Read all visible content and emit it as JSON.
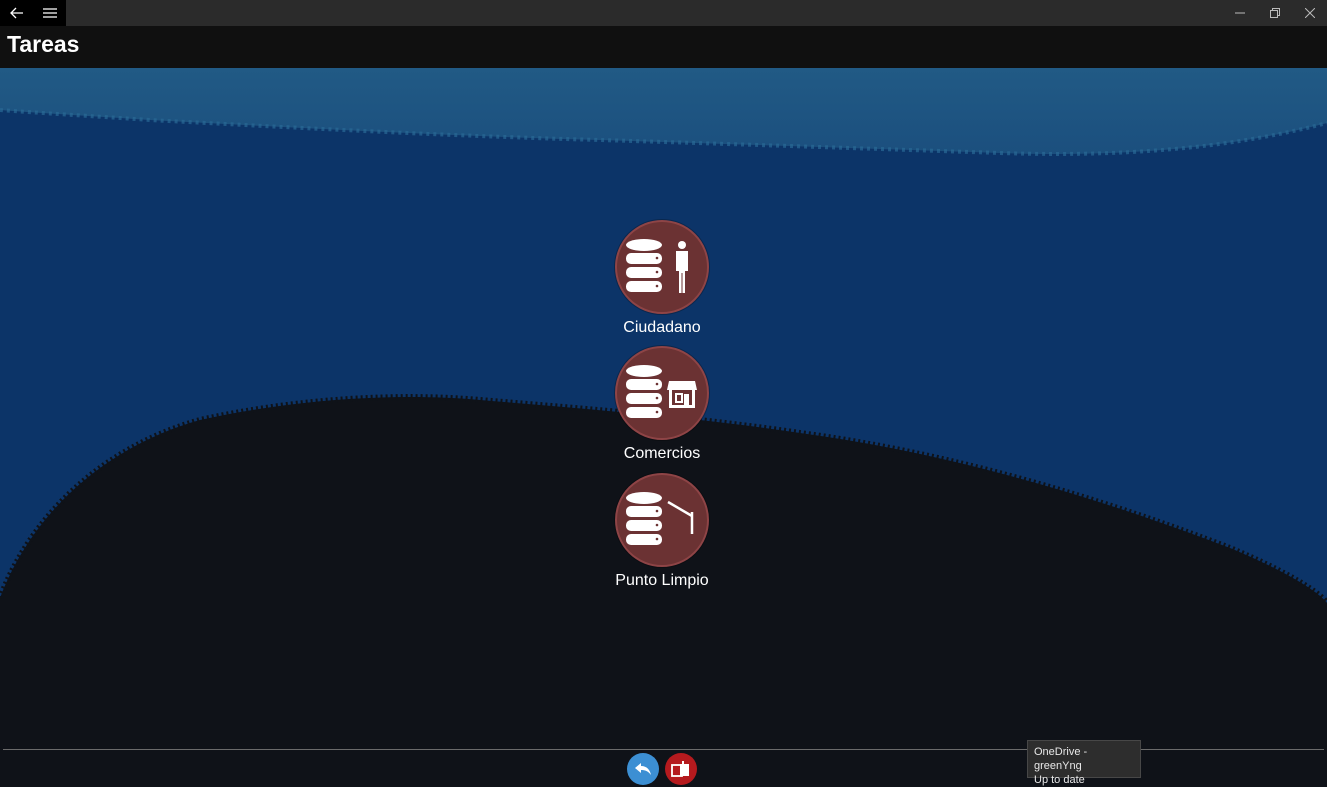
{
  "window": {
    "back_icon": "arrow-left-icon",
    "menu_icon": "hamburger-menu-icon",
    "controls": [
      "minimize-icon",
      "restore-icon",
      "close-icon"
    ]
  },
  "header": {
    "title": "Tareas"
  },
  "tasks": [
    {
      "label": "Ciudadano",
      "icon": "database-person-icon"
    },
    {
      "label": "Comercios",
      "icon": "database-store-icon"
    },
    {
      "label": "Punto Limpio",
      "icon": "database-barrier-icon"
    }
  ],
  "bottom_bar": {
    "back_button": {
      "icon": "reply-arrow-icon",
      "color": "#3c8fd3"
    },
    "exit_button": {
      "icon": "exit-door-icon",
      "color": "#b51a1e"
    }
  },
  "tooltip": {
    "line1": "OneDrive - greenYng",
    "line2": "Up to date"
  },
  "colors": {
    "task_circle": "#6b3233",
    "sky": "#0c3468",
    "ground": "#0f1218"
  }
}
